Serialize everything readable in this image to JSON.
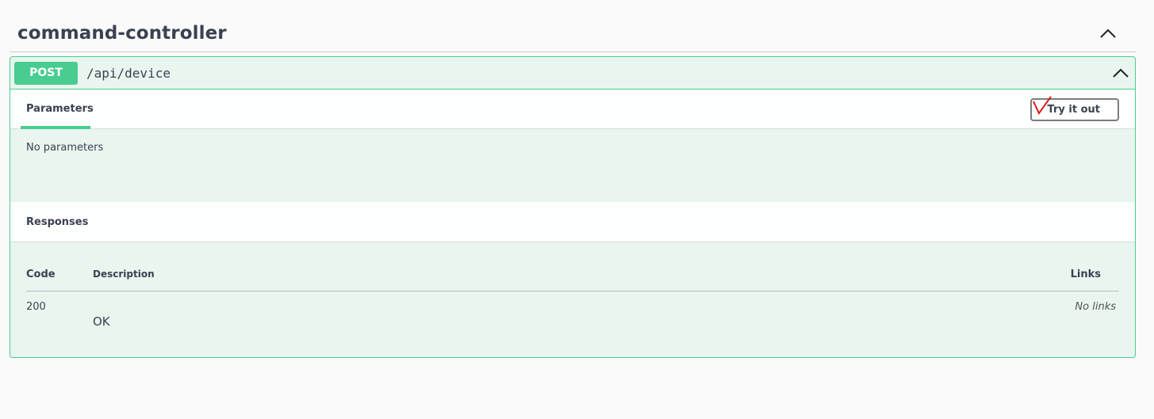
{
  "tag": {
    "title": "command-controller"
  },
  "operation": {
    "method": "POST",
    "path": "/api/device",
    "color": "#49cc90"
  },
  "parameters": {
    "tab_label": "Parameters",
    "try_button_label": "Try it out",
    "empty_text": "No parameters"
  },
  "responses": {
    "title": "Responses",
    "columns": {
      "code": "Code",
      "description": "Description",
      "links": "Links"
    },
    "rows": [
      {
        "code": "200",
        "description": "OK",
        "links": "No links"
      }
    ]
  },
  "icons": {
    "collapse_tag": "chevron-up-icon",
    "collapse_operation": "chevron-up-icon",
    "annotation": "checkmark-icon"
  }
}
